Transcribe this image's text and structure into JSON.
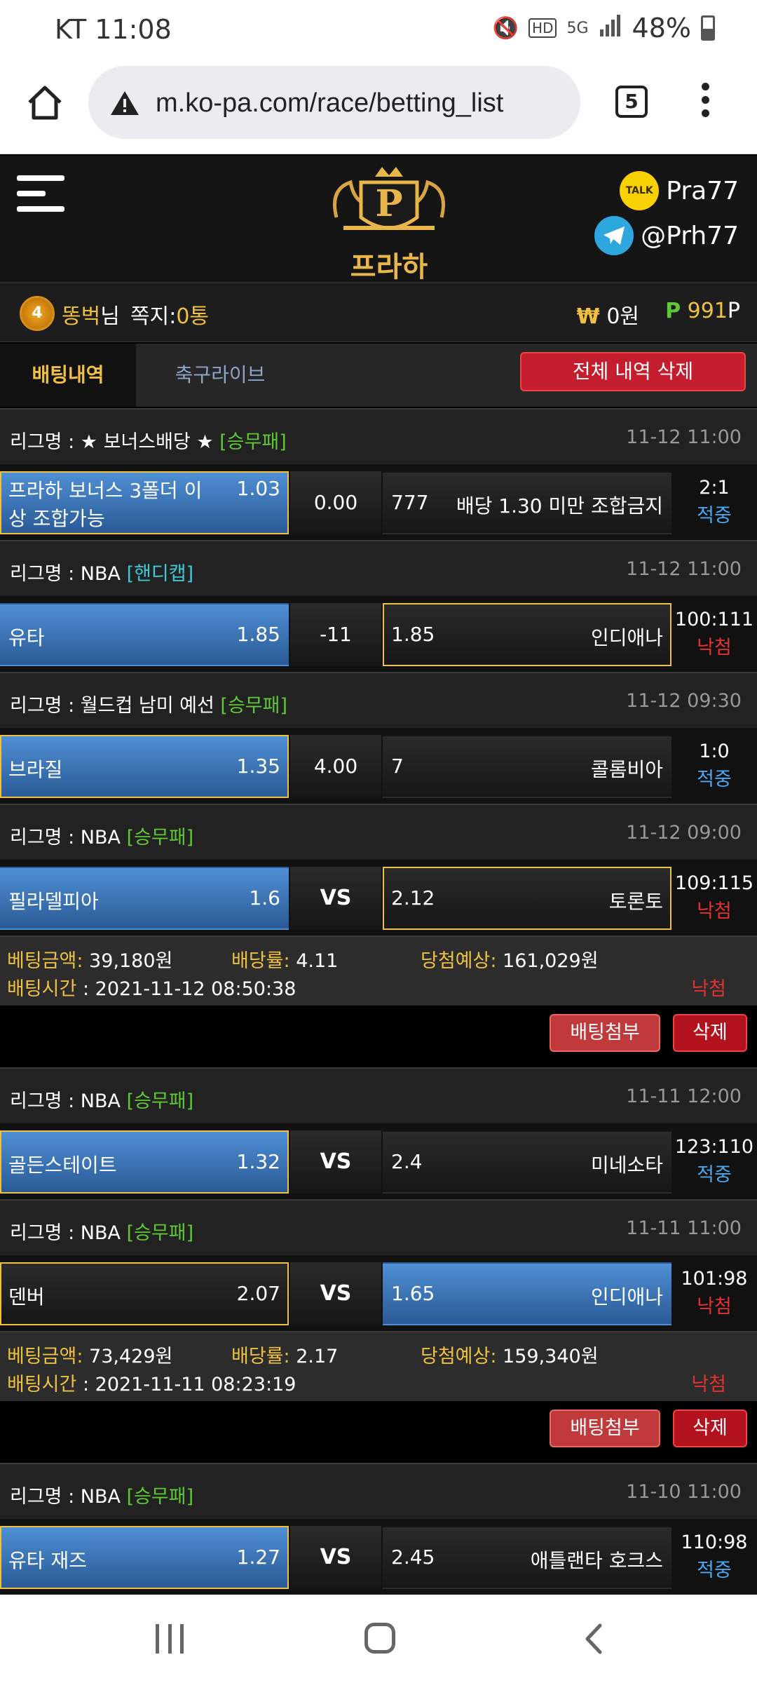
{
  "status_bar": {
    "carrier_time": "KT 11:08",
    "network": "5G",
    "battery": "48%"
  },
  "browser": {
    "url": "m.ko-pa.com/race/betting_list",
    "tab_count": "5"
  },
  "header": {
    "logo_text": "프라하",
    "kakao_id": "Pra77",
    "telegram_id": "@Prh77"
  },
  "user": {
    "level": "4",
    "name": "똥벅",
    "name_suffix": "님",
    "msg_label": "쪽지:",
    "msg_count": "0통",
    "money_symbol": "₩",
    "money": "0원",
    "point_symbol": "P",
    "points": "991",
    "point_unit": "P"
  },
  "tabs": {
    "bet_history": "배팅내역",
    "soccer_live": "축구라이브",
    "delete_all": "전체 내역 삭제"
  },
  "slips": [
    {
      "games": [
        {
          "league": "리그명 : ★ 보너스배당 ★ ",
          "type": "[승무패]",
          "datetime": "11-12 11:00",
          "home": "프라하 보너스 3폴더 이상 조합가능",
          "home_odds": "1.03",
          "mid": "0.00",
          "away_odds": "777",
          "away": "배당 1.30 미만 조합금지",
          "score": "2:1",
          "result": "적중"
        },
        {
          "league": "리그명 : NBA ",
          "type": "[핸디캡]",
          "datetime": "11-12 11:00",
          "home": "유타",
          "home_odds": "1.85",
          "mid": "-11",
          "away_odds": "1.85",
          "away": "인디애나",
          "score": "100:111",
          "result": "낙첨"
        },
        {
          "league": "리그명 : 월드컵 남미 예선 ",
          "type": "[승무패]",
          "datetime": "11-12 09:30",
          "home": "브라질",
          "home_odds": "1.35",
          "mid": "4.00",
          "away_odds": "7",
          "away": "콜롬비아",
          "score": "1:0",
          "result": "적중"
        },
        {
          "league": "리그명 : NBA ",
          "type": "[승무패]",
          "datetime": "11-12 09:00",
          "home": "필라델피아",
          "home_odds": "1.6",
          "mid": "VS",
          "away_odds": "2.12",
          "away": "토론토",
          "score": "109:115",
          "result": "낙첨"
        }
      ],
      "summary": {
        "amount_label": "베팅금액:",
        "amount": " 39,180원",
        "rate_label": "배당률:",
        "rate": " 4.11",
        "expected_label": "당첨예상:",
        "expected": " 161,029원",
        "time_label": "배팅시간",
        "time": " : 2021-11-12 08:50:38",
        "result": "낙첨"
      }
    },
    {
      "games": [
        {
          "league": "리그명 : NBA ",
          "type": "[승무패]",
          "datetime": "11-11 12:00",
          "home": "골든스테이트",
          "home_odds": "1.32",
          "mid": "VS",
          "away_odds": "2.4",
          "away": "미네소타",
          "score": "123:110",
          "result": "적중"
        },
        {
          "league": "리그명 : NBA ",
          "type": "[승무패]",
          "datetime": "11-11 11:00",
          "home": "덴버",
          "home_odds": "2.07",
          "mid": "VS",
          "away_odds": "1.65",
          "away": "인디애나",
          "score": "101:98",
          "result": "낙첨"
        }
      ],
      "summary": {
        "amount_label": "베팅금액:",
        "amount": " 73,429원",
        "rate_label": "배당률:",
        "rate": " 2.17",
        "expected_label": "당첨예상:",
        "expected": " 159,340원",
        "time_label": "배팅시간",
        "time": " : 2021-11-11 08:23:19",
        "result": "낙첨"
      }
    },
    {
      "games": [
        {
          "league": "리그명 : NBA ",
          "type": "[승무패]",
          "datetime": "11-10 11:00",
          "home": "유타 재즈",
          "home_odds": "1.27",
          "mid": "VS",
          "away_odds": "2.45",
          "away": "애틀랜타 호크스",
          "score": "110:98",
          "result": "적중"
        }
      ]
    }
  ],
  "actions": {
    "attach": "배팅첨부",
    "delete": "삭제"
  }
}
